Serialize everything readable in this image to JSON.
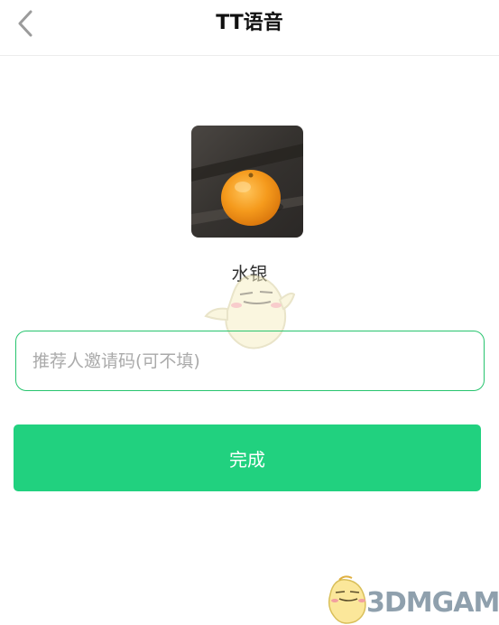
{
  "header": {
    "back_icon": "chevron-left-icon",
    "title": "TT语音"
  },
  "profile": {
    "avatar": "orange-photo",
    "nickname": "水银"
  },
  "form": {
    "invite_code_value": "",
    "invite_code_placeholder": "推荐人邀请码(可不填)",
    "submit_label": "完成"
  },
  "colors": {
    "accent": "#21d17f",
    "field_border": "#27c46e"
  },
  "watermark": {
    "text": "3DMGAME"
  }
}
